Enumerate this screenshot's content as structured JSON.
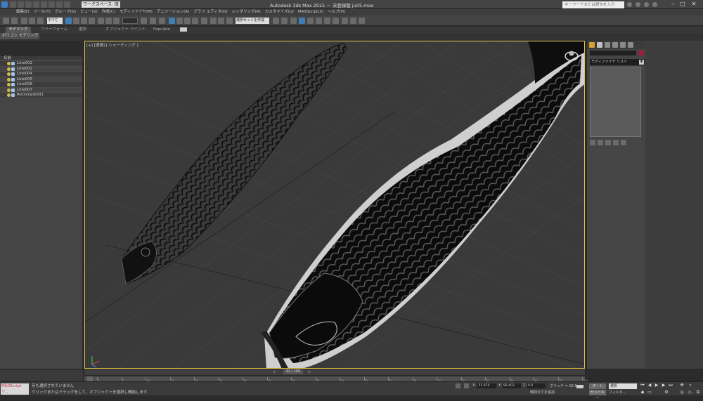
{
  "app": {
    "title": "Autodesk 3ds Max  2015  － 未登録版    ju05.max",
    "workspace": "ワークスペース: 既定値",
    "search_placeholder": "キーワードまたは語句を入力"
  },
  "menu": [
    "編集(E)",
    "ツール(T)",
    "グループ(G)",
    "ビュー(V)",
    "作成(C)",
    "モディファイヤ(M)",
    "アニメーション(A)",
    "グラフ エディタ(D)",
    "レンダリング(R)",
    "カスタマイズ(U)",
    "MAXScript(X)",
    "ヘルプ(H)"
  ],
  "toolbar": {
    "selection_filter": "すべて",
    "named_selection": "選択セットを作成"
  },
  "ribbon": {
    "tabs": [
      "モデリング",
      "フリーフォーム",
      "選択",
      "オブジェクト ペイント",
      "Populate"
    ],
    "panel": "ポリゴン モデリング"
  },
  "explorer": {
    "header": "名前",
    "items": [
      "Line002",
      "Line002",
      "Line004",
      "Line005",
      "Line006",
      "Line007",
      "Rectangle001"
    ]
  },
  "viewport": {
    "label": "[+] [透視] [ シェーディング ]"
  },
  "command_panel": {
    "modifier_list": "モディファイヤ リスト"
  },
  "timeline": {
    "frame_label": "42 / 100",
    "ticks": [
      "0",
      "5",
      "10",
      "15",
      "20",
      "25",
      "30",
      "35",
      "40",
      "45",
      "50",
      "55",
      "60",
      "65",
      "70",
      "75",
      "80",
      "85",
      "90",
      "95",
      "100"
    ]
  },
  "status": {
    "maxscript": "MAXScript リ...",
    "line1": "何も選択されていません",
    "line2": "クリックまたはドラッグをして、オブジェクトを選択し開始します",
    "x_label": "X:",
    "x_value": "-55.976",
    "y_label": "Y:",
    "y_value": "98.403",
    "z_label": "Z:",
    "z_value": "0.0",
    "grid": "グリッド = 10.0",
    "add_time_tag": "時間タグを追加",
    "auto": "オート",
    "set_key": "セットキー",
    "selection_combo": "選択",
    "filter": "フィルタ..."
  },
  "colors": {
    "viewport_border": "#e2c24a",
    "object_color": "#9c1f3a",
    "maxscript_text": "#c0303a"
  }
}
